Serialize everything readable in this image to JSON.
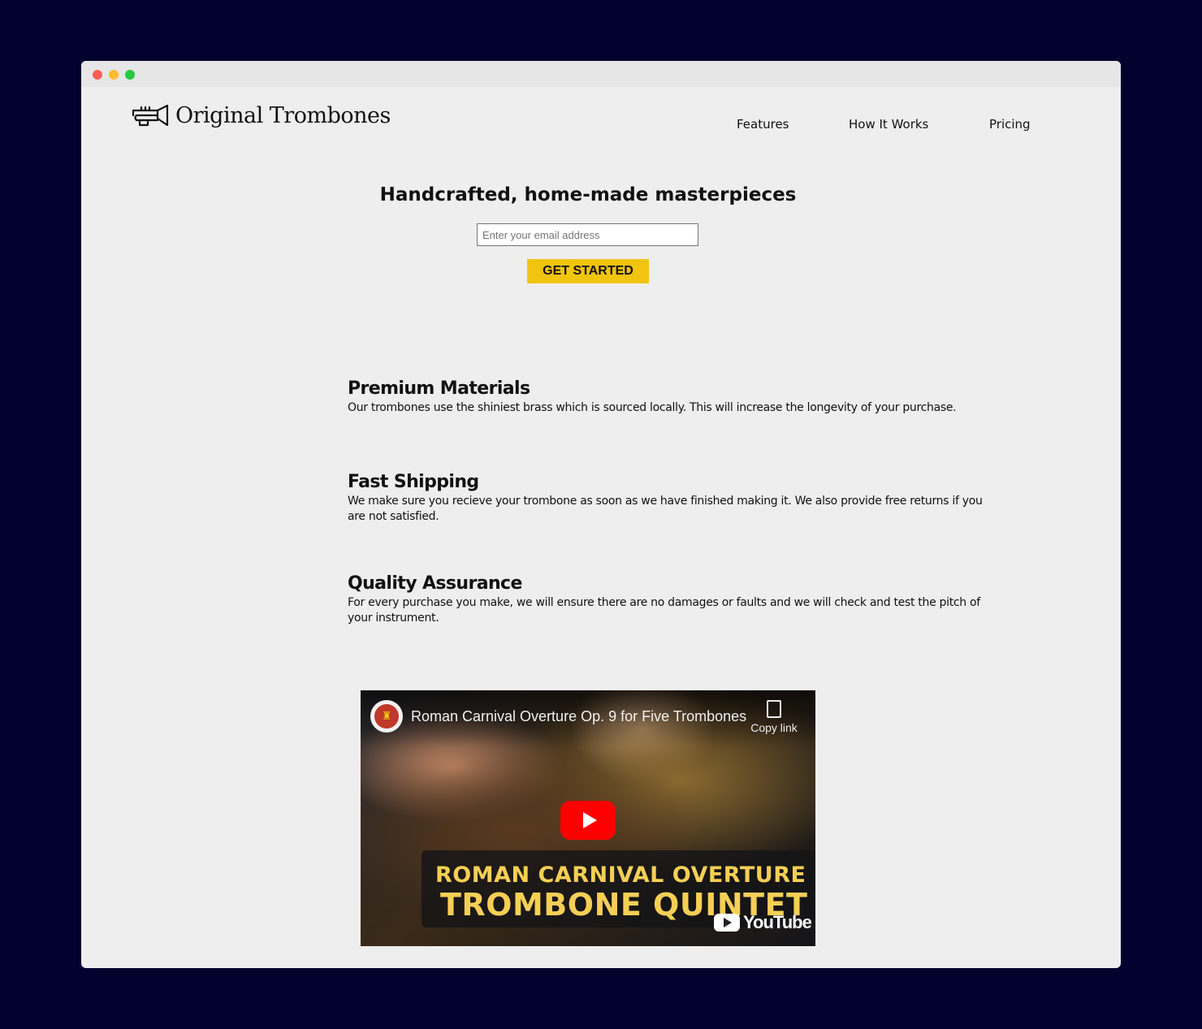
{
  "brand": {
    "name": "Original Trombones",
    "logo_icon": "trombone-icon"
  },
  "nav": {
    "items": [
      {
        "label": "Features"
      },
      {
        "label": "How It Works"
      },
      {
        "label": "Pricing"
      }
    ]
  },
  "hero": {
    "title": "Handcrafted, home-made masterpieces",
    "email_placeholder": "Enter your email address",
    "cta_label": "GET STARTED"
  },
  "features": [
    {
      "title": "Premium Materials",
      "text": "Our trombones use the shiniest brass which is sourced locally. This will increase the longevity of your purchase."
    },
    {
      "title": "Fast Shipping",
      "text": "We make sure you recieve your trombone as soon as we have finished making it. We also provide free returns if you are not satisfied."
    },
    {
      "title": "Quality Assurance",
      "text": "For every purchase you make, we will ensure there are no damages or faults and we will check and test the pitch of your instrument."
    }
  ],
  "video": {
    "title": "Roman Carnival Overture Op. 9 for Five Trombones",
    "copy_link_label": "Copy link",
    "banner_line1": "ROMAN CARNIVAL OVERTURE",
    "banner_line2": "TROMBONE QUINTET",
    "platform_label": "YouTube"
  },
  "colors": {
    "page_background": "#02022e",
    "window_background": "#eeeeee",
    "cta_background": "#f1c40f",
    "play_button": "#ff0000",
    "banner_text": "#f5cf55"
  }
}
